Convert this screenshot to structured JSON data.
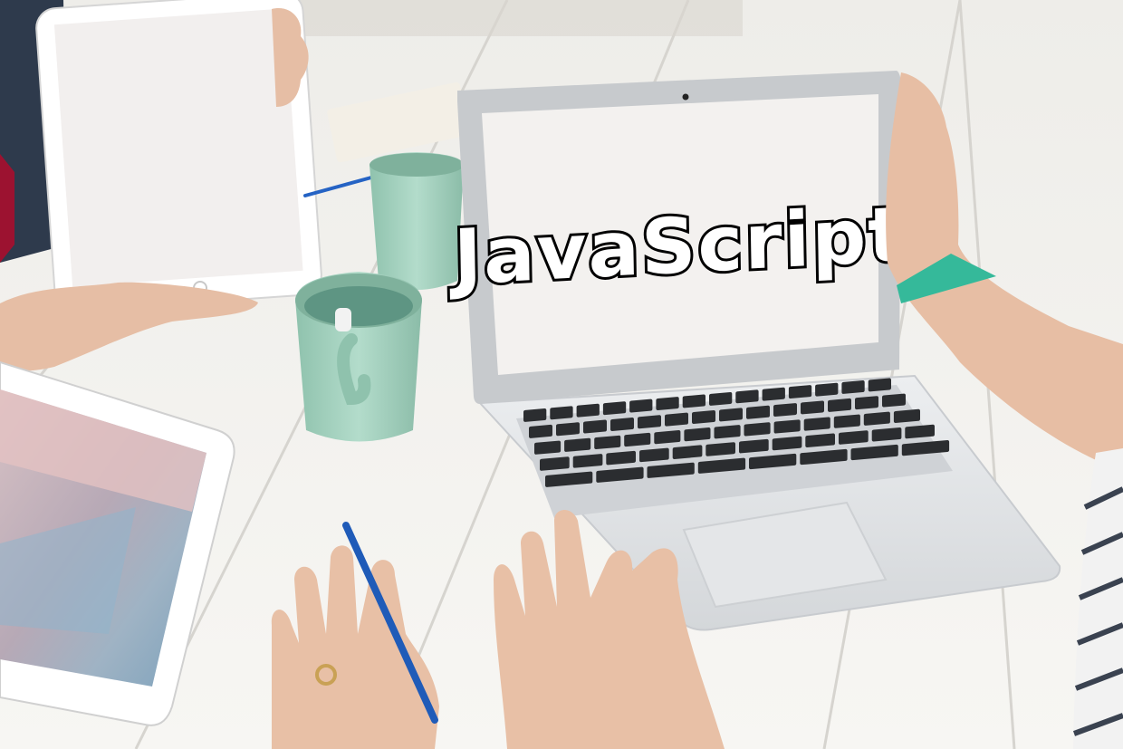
{
  "screen": {
    "title": "JavaScript"
  },
  "keyboard": {
    "rows": [
      14,
      14,
      13,
      12,
      8
    ]
  },
  "colors": {
    "table": "#f4f3f0",
    "table_seam": "#d9d7d2",
    "laptop_body": "#e3e4e6",
    "laptop_bezel": "#b9bcc0",
    "screen": "#f3f1ef",
    "key": "#2b2d30",
    "mug": "#a9d3c1",
    "tablet": "#fbfbfb",
    "skin": "#e8c1a8",
    "pen": "#1f5bb8",
    "title_stroke": "#000000"
  },
  "icons": {
    "camera": "camera-icon",
    "home_button": "home-button-icon"
  }
}
